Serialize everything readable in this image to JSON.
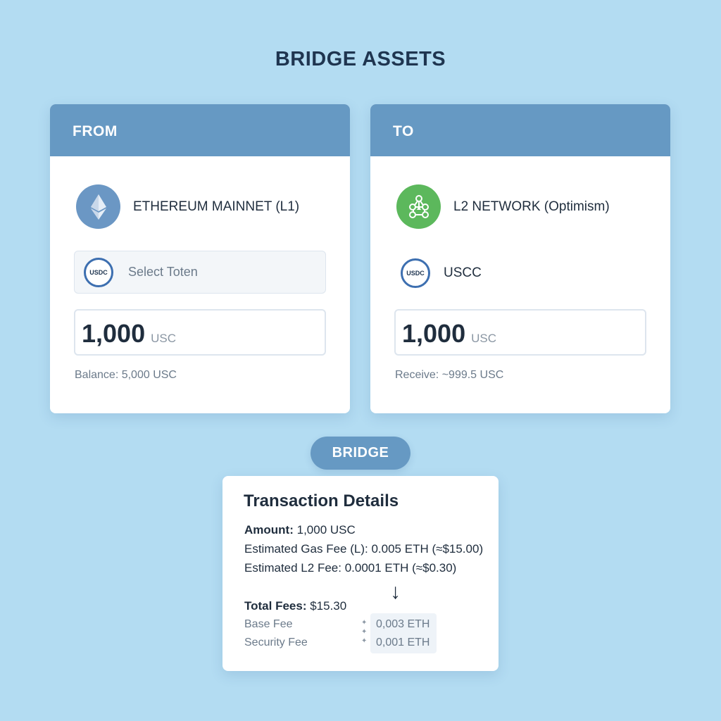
{
  "title": "BRIDGE ASSETS",
  "from_card": {
    "header": "FROM",
    "network": "ETHEREUM MAINNET (L1)",
    "token_badge": "USDC",
    "token_placeholder": "Select Toten",
    "amount": "1,000",
    "amount_unit": "USC",
    "balance": "Balance: 5,000 USC",
    "network_icon": "ethereum-icon"
  },
  "to_card": {
    "header": "TO",
    "network": "L2 NETWORK (Optimism)",
    "token_badge": "USDC",
    "token_name": "USCC",
    "amount": "1,000",
    "amount_unit": "USC",
    "receive": "Receive: ~999.5 USC",
    "network_icon": "network-nodes-icon"
  },
  "bridge_button": "BRIDGE",
  "details": {
    "title": "Transaction Details",
    "amount_label": "Amount:",
    "amount_value": "1,000 USC",
    "gas_label": "Estimated Gas Fee (L):",
    "gas_value": "0.005 ETH (≈$15.00)",
    "l2_label": "Estimated L2 Fee:",
    "l2_value": "0.0001 ETH (≈$0.30)",
    "arrow": "↓",
    "total_label": "Total Fees:",
    "total_value": "$15.30",
    "base_fee_label": "Base Fee",
    "base_fee_value": "0,003 ETH",
    "security_fee_label": "Security Fee",
    "security_fee_value": "0,001 ETH"
  },
  "colors": {
    "background": "#b3dcf2",
    "header": "#6699c3",
    "ethereum": "#6b97c4",
    "l2": "#5cb85c",
    "usdc_ring": "#3d6fb0"
  }
}
